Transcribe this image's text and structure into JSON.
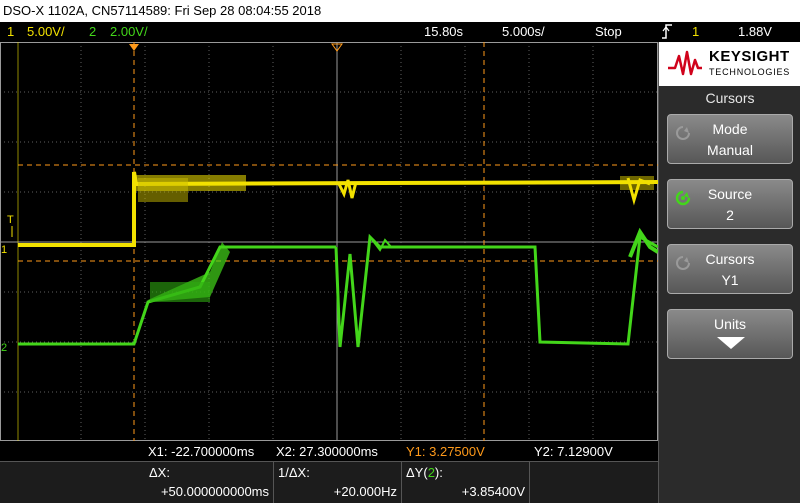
{
  "title_bar": {
    "text": "DSO-X 1102A, CN57114589: Fri Sep 28 08:04:55 2018"
  },
  "status": {
    "ch1_num": "1",
    "ch1_scale": "5.00V/",
    "ch2_num": "2",
    "ch2_scale": "2.00V/",
    "time_pos": "15.80s",
    "time_scale": "5.000s/",
    "run_state": "Stop",
    "trig_source": "1",
    "trig_level": "1.88V"
  },
  "markers": {
    "ch1": "1",
    "ch2": "2",
    "trigger": "T"
  },
  "cursor_readout": {
    "x1": "X1: -22.700000ms",
    "x2": "X2: 27.300000ms",
    "y1": "Y1: 3.27500V",
    "y2": "Y2: 7.12900V"
  },
  "deltas": {
    "dx_label": "ΔX:",
    "dx_value": "+50.000000000ms",
    "inv_dx_label": "1/ΔX:",
    "inv_dx_value": "+20.000Hz",
    "dy_label_prefix": "ΔY(",
    "dy_channel": "2",
    "dy_label_suffix": "):",
    "dy_value": "+3.85400V"
  },
  "side_panel": {
    "brand": "KEYSIGHT",
    "brand_sub": "TECHNOLOGIES",
    "menu_title": "Cursors",
    "softkeys": [
      {
        "label": "Mode",
        "value": "Manual"
      },
      {
        "label": "Source",
        "value": "2"
      },
      {
        "label": "Cursors",
        "value": "Y1"
      },
      {
        "label": "Units",
        "value": ""
      }
    ]
  },
  "colors": {
    "ch1": "#f2e100",
    "ch2": "#43d61a",
    "cursor": "#ff9a1a",
    "grid": "#6a6a6a"
  },
  "icons": [
    "keysight-wave-logo",
    "trigger-edge-icon",
    "knob-icon",
    "down-arrow-icon"
  ]
}
